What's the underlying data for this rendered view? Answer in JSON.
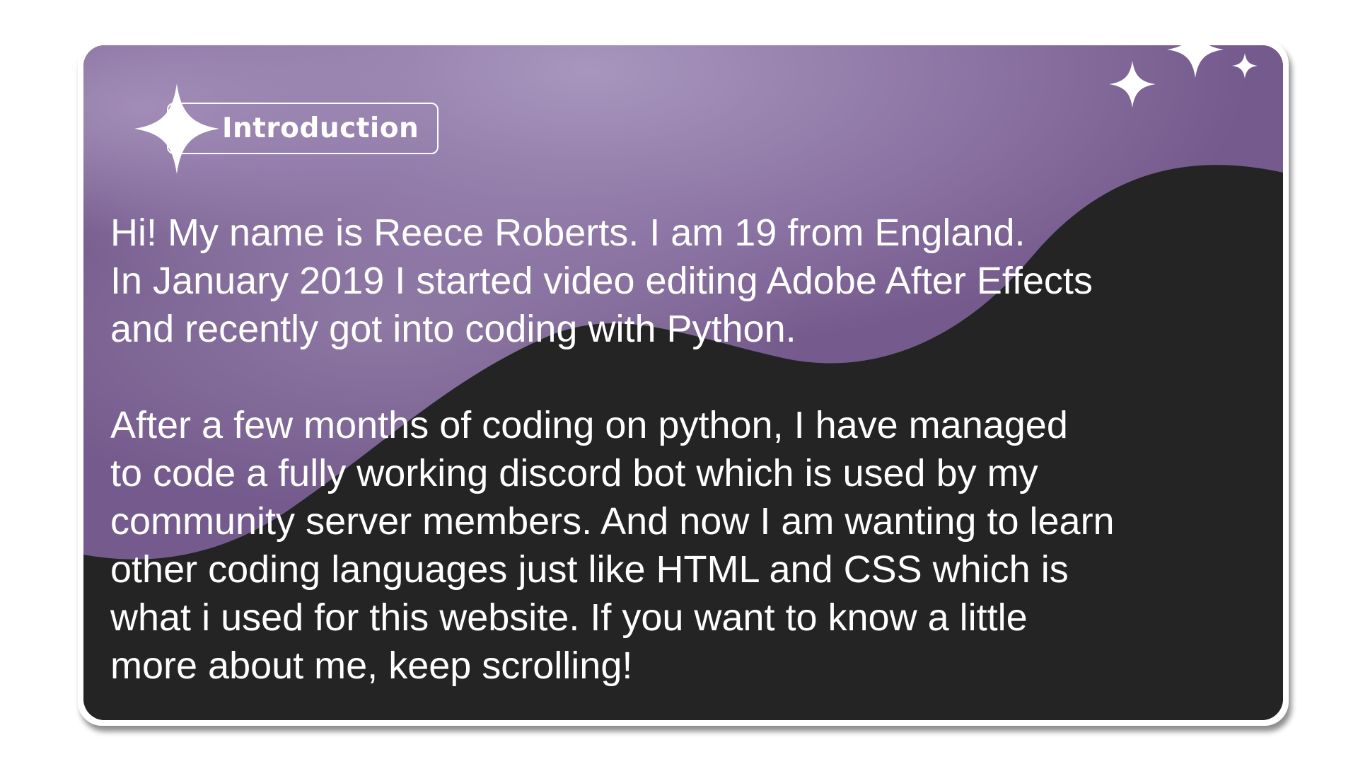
{
  "card": {
    "tag_label": "Introduction",
    "paragraphs": [
      {
        "lines": [
          "Hi! My name is Reece Roberts. I am 19 from England.",
          "In January 2019 I started video editing Adobe After Effects",
          "and recently got into coding with Python."
        ]
      },
      {
        "lines": [
          "After a few months of coding on python, I have managed",
          "to code a fully working discord bot which is used by my",
          "community server members. And now I am wanting to learn",
          "other coding languages just like HTML and CSS which is",
          "what i used for this website. If you want to know a little",
          "more about me, keep scrolling!"
        ]
      }
    ]
  },
  "colors": {
    "purple_light": "#9a88b0",
    "purple": "#7e6596",
    "dark": "#242424",
    "text": "#ffffff"
  },
  "icons": [
    "sparkle-icon"
  ]
}
